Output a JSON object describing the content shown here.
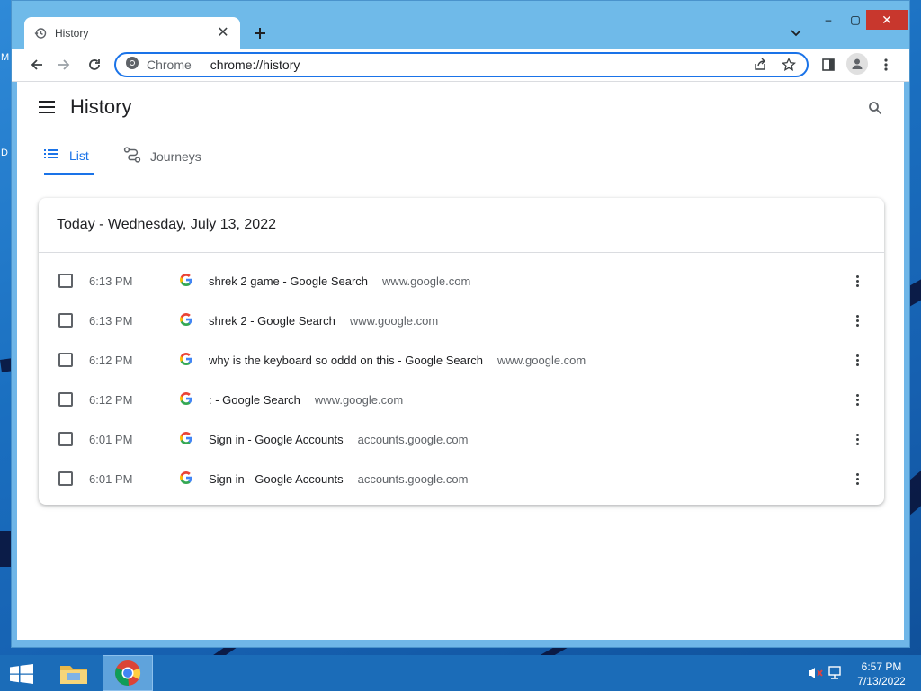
{
  "desktop": {
    "left_labels": [
      "M",
      "D"
    ]
  },
  "browser": {
    "tab": {
      "title": "History",
      "favicon": "history-icon"
    },
    "window_controls": {
      "minimize": "–",
      "maximize": "▢",
      "close": "✕"
    },
    "omnibox": {
      "chip": "Chrome",
      "url": "chrome://history"
    }
  },
  "history_page": {
    "title": "History",
    "tabs": [
      {
        "label": "List",
        "icon": "list-icon",
        "active": true
      },
      {
        "label": "Journeys",
        "icon": "journeys-icon",
        "active": false
      }
    ],
    "day_header": "Today - Wednesday, July 13, 2022",
    "entries": [
      {
        "time": "6:13 PM",
        "title": "shrek 2 game - Google Search",
        "domain": "www.google.com"
      },
      {
        "time": "6:13 PM",
        "title": "shrek 2 - Google Search",
        "domain": "www.google.com"
      },
      {
        "time": "6:12 PM",
        "title": "why is the keyboard so oddd on this - Google Search",
        "domain": "www.google.com"
      },
      {
        "time": "6:12 PM",
        "title": ": - Google Search",
        "domain": "www.google.com"
      },
      {
        "time": "6:01 PM",
        "title": "Sign in - Google Accounts",
        "domain": "accounts.google.com"
      },
      {
        "time": "6:01 PM",
        "title": "Sign in - Google Accounts",
        "domain": "accounts.google.com"
      }
    ]
  },
  "taskbar": {
    "apps": [
      "windows-start-icon",
      "file-explorer-icon",
      "chrome-icon"
    ],
    "clock": {
      "time": "6:57 PM",
      "date": "7/13/2022"
    }
  },
  "colors": {
    "accent": "#1a73e8",
    "taskbar": "#1b6cb8",
    "close_button": "#c8372d"
  }
}
